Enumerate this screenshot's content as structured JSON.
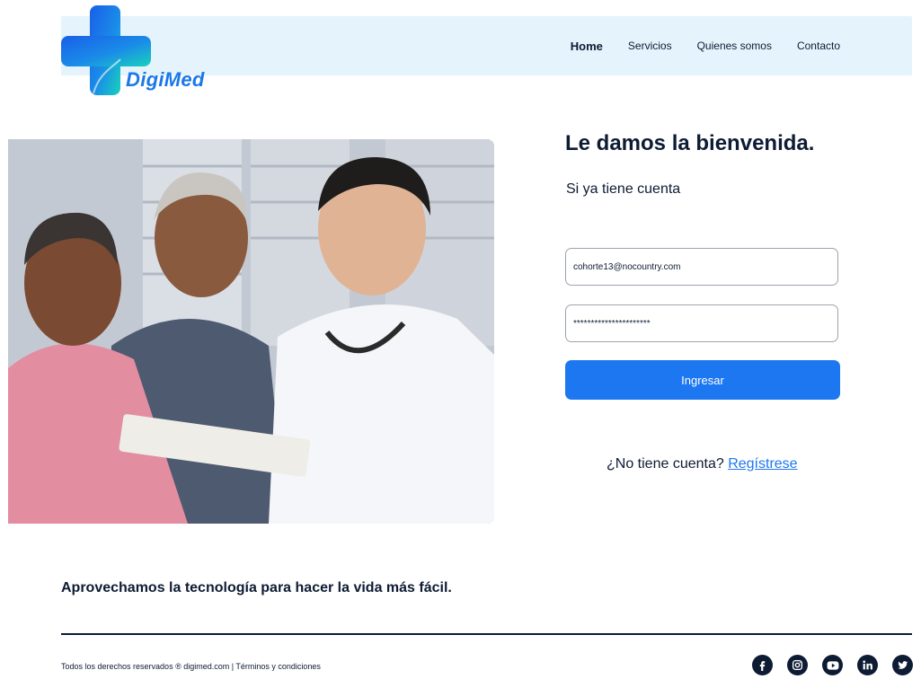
{
  "brand": {
    "name": "DigiMed"
  },
  "nav": {
    "items": [
      {
        "label": "Home",
        "active": true
      },
      {
        "label": "Servicios"
      },
      {
        "label": "Quienes somos"
      },
      {
        "label": "Contacto"
      }
    ]
  },
  "login": {
    "title": "Le damos la bienvenida.",
    "subtitle": "Si ya tiene cuenta",
    "email_value": "cohorte13@nocountry.com",
    "password_value": "**********************",
    "submit_label": "Ingresar",
    "signup_prompt": "¿No tiene cuenta?",
    "signup_link": "Regístrese"
  },
  "footer": {
    "tagline": "Aprovechamos la tecnología para hacer la vida más fácil.",
    "copyright": "Todos los derechos reservados ® digimed.com  | Términos y condiciones",
    "socials": [
      "facebook-icon",
      "instagram-icon",
      "youtube-icon",
      "linkedin-icon",
      "twitter-icon"
    ]
  },
  "colors": {
    "primary": "#1c77f0",
    "navy": "#0d1b33",
    "nav_bg": "#e4f3fc",
    "logo_teal": "#18c5c0"
  }
}
